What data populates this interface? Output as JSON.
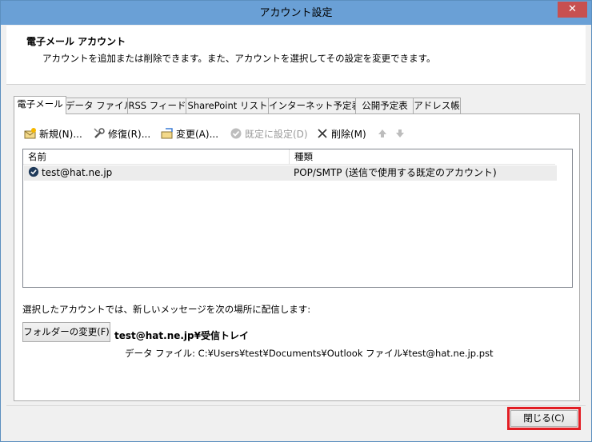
{
  "window": {
    "title": "アカウント設定"
  },
  "header": {
    "title": "電子メール アカウント",
    "description": "アカウントを追加または削除できます。また、アカウントを選択してその設定を変更できます。"
  },
  "tabs": [
    {
      "label": "電子メール",
      "active": true
    },
    {
      "label": "データ ファイル"
    },
    {
      "label": "RSS フィード"
    },
    {
      "label": "SharePoint リスト"
    },
    {
      "label": "インターネット予定表"
    },
    {
      "label": "公開予定表"
    },
    {
      "label": "アドレス帳"
    }
  ],
  "toolbar": {
    "new_label": "新規(N)...",
    "repair_label": "修復(R)...",
    "change_label": "変更(A)...",
    "default_label": "既定に設定(D)",
    "delete_label": "削除(M)"
  },
  "list": {
    "columns": [
      "名前",
      "種類"
    ],
    "rows": [
      {
        "name": "test@hat.ne.jp",
        "type": "POP/SMTP (送信で使用する既定のアカウント)"
      }
    ]
  },
  "delivery": {
    "label": "選択したアカウントでは、新しいメッセージを次の場所に配信します:",
    "change_folder_button": "フォルダーの変更(F)",
    "folder": "test@hat.ne.jp¥受信トレイ",
    "data_file": "データ ファイル: C:¥Users¥test¥Documents¥Outlook ファイル¥test@hat.ne.jp.pst"
  },
  "footer": {
    "close_button": "閉じる(C)"
  },
  "colors": {
    "titlebar": "#6aa0d6",
    "close_button": "#c75050",
    "highlight_outline": "#e21e24"
  }
}
